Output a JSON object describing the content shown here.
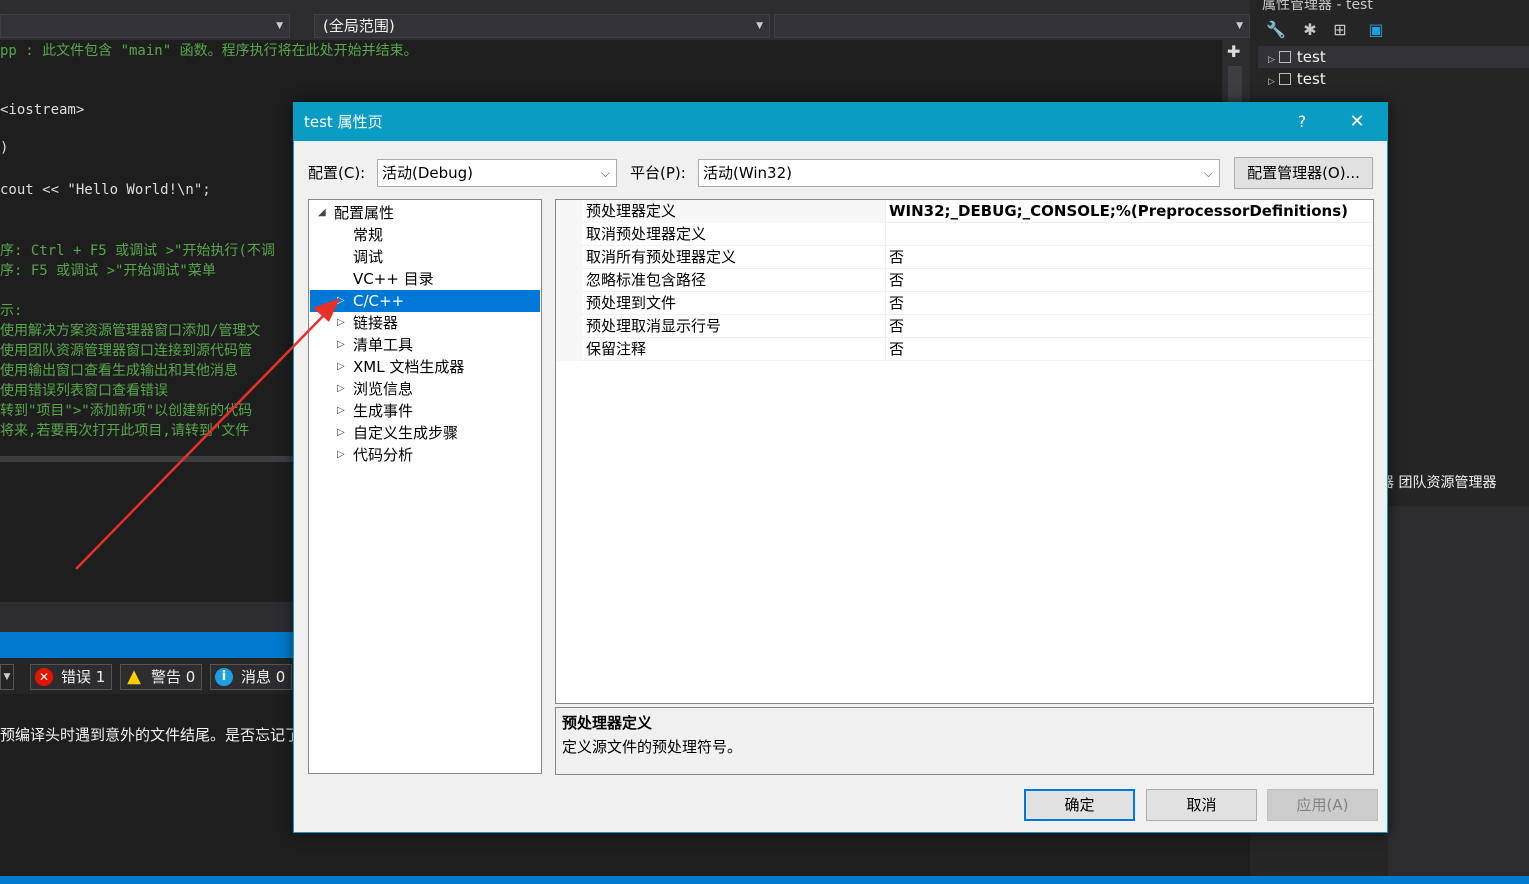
{
  "ide": {
    "scope_combo": "(全局范围)",
    "code_lines": [
      {
        "text": "pp : 此文件包含 \"main\" 函数。程序执行将在此处开始并结束。",
        "cls": ""
      },
      {
        "text": "<iostream>",
        "cls": "plain"
      },
      {
        "text": ")",
        "cls": "plain"
      },
      {
        "text": "cout << \"Hello World!\\n\";",
        "cls": "plain"
      },
      {
        "text": "序: Ctrl + F5 或调试 >\"开始执行(不调",
        "cls": ""
      },
      {
        "text": "序: F5 或调试 >\"开始调试\"菜单",
        "cls": ""
      },
      {
        "text": "示:",
        "cls": ""
      },
      {
        "text": "使用解决方案资源管理器窗口添加/管理文",
        "cls": ""
      },
      {
        "text": "使用团队资源管理器窗口连接到源代码管",
        "cls": ""
      },
      {
        "text": "使用输出窗口查看生成输出和其他消息",
        "cls": ""
      },
      {
        "text": "使用错误列表窗口查看错误",
        "cls": ""
      },
      {
        "text": "转到\"项目\">\"添加新项\"以创建新的代码",
        "cls": ""
      },
      {
        "text": "将来,若要再次打开此项目,请转到\"文件",
        "cls": ""
      }
    ],
    "error_list": {
      "errors": "错误 1",
      "warnings": "警告 0",
      "messages": "消息 0",
      "first_error": "预编译头时遇到意外的文件结尾。是否忘记了"
    },
    "right_panel": {
      "title": "属性管理器 - test",
      "items": [
        "test",
        "test"
      ],
      "tabs": "器  团队资源管理器"
    }
  },
  "dialog": {
    "title": "test 属性页",
    "help": "?",
    "close": "✕",
    "config_label": "配置(C):",
    "config_value": "活动(Debug)",
    "platform_label": "平台(P):",
    "platform_value": "活动(Win32)",
    "config_manager_button": "配置管理器(O)...",
    "tree": [
      {
        "label": "配置属性",
        "level": 0,
        "exp": "◢",
        "selected": false
      },
      {
        "label": "常规",
        "level": 1,
        "exp": "",
        "selected": false
      },
      {
        "label": "调试",
        "level": 1,
        "exp": "",
        "selected": false
      },
      {
        "label": "VC++ 目录",
        "level": 1,
        "exp": "",
        "selected": false
      },
      {
        "label": "C/C++",
        "level": 1,
        "exp": "▷",
        "selected": true
      },
      {
        "label": "链接器",
        "level": 1,
        "exp": "▷",
        "selected": false
      },
      {
        "label": "清单工具",
        "level": 1,
        "exp": "▷",
        "selected": false
      },
      {
        "label": "XML 文档生成器",
        "level": 1,
        "exp": "▷",
        "selected": false
      },
      {
        "label": "浏览信息",
        "level": 1,
        "exp": "▷",
        "selected": false
      },
      {
        "label": "生成事件",
        "level": 1,
        "exp": "▷",
        "selected": false
      },
      {
        "label": "自定义生成步骤",
        "level": 1,
        "exp": "▷",
        "selected": false
      },
      {
        "label": "代码分析",
        "level": 1,
        "exp": "▷",
        "selected": false
      }
    ],
    "properties": [
      {
        "name": "预处理器定义",
        "value": "WIN32;_DEBUG;_CONSOLE;%(PreprocessorDefinitions)"
      },
      {
        "name": "取消预处理器定义",
        "value": ""
      },
      {
        "name": "取消所有预处理器定义",
        "value": "否"
      },
      {
        "name": "忽略标准包含路径",
        "value": "否"
      },
      {
        "name": "预处理到文件",
        "value": "否"
      },
      {
        "name": "预处理取消显示行号",
        "value": "否"
      },
      {
        "name": "保留注释",
        "value": "否"
      }
    ],
    "description": {
      "title": "预处理器定义",
      "text": "定义源文件的预处理符号。"
    },
    "ok_button": "确定",
    "cancel_button": "取消",
    "apply_button": "应用(A)"
  },
  "colors": {
    "accent": "#0a9cc2",
    "selection": "#0078d7",
    "annotation_arrow": "#e8302a",
    "comment_green": "#57a64a"
  }
}
